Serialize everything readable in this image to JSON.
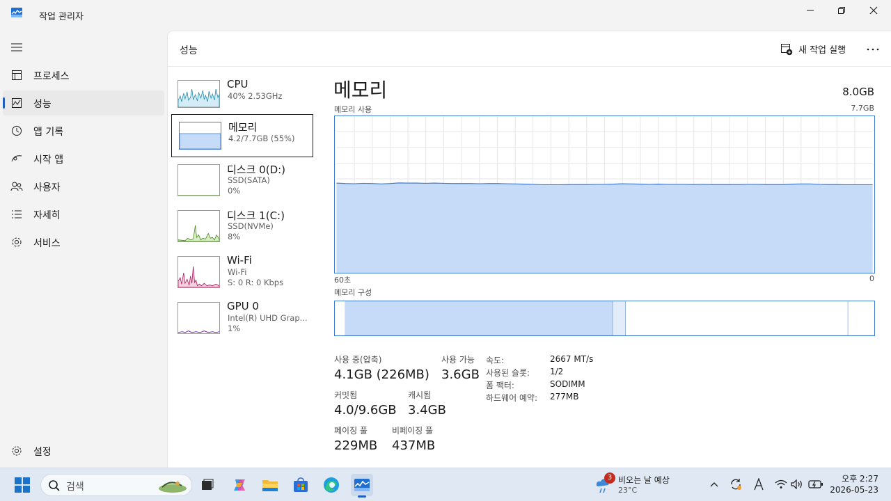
{
  "window": {
    "title": "작업 관리자"
  },
  "sidebar": {
    "items": [
      {
        "label": "프로세스",
        "icon": "processes-icon"
      },
      {
        "label": "성능",
        "icon": "performance-icon"
      },
      {
        "label": "앱 기록",
        "icon": "app-history-icon"
      },
      {
        "label": "시작 앱",
        "icon": "startup-apps-icon"
      },
      {
        "label": "사용자",
        "icon": "users-icon"
      },
      {
        "label": "자세히",
        "icon": "details-icon"
      },
      {
        "label": "서비스",
        "icon": "services-icon"
      }
    ],
    "settings_label": "설정"
  },
  "header": {
    "title": "성능",
    "run_task_label": "새 작업 실행"
  },
  "devices": [
    {
      "name": "CPU",
      "sub1": "40% 2.53GHz",
      "sub2": "",
      "color": "#1a8aaa"
    },
    {
      "name": "메모리",
      "sub1": "4.2/7.7GB (55%)",
      "sub2": "",
      "color": "#3f7ad1"
    },
    {
      "name": "디스크 0(D:)",
      "sub1": "SSD(SATA)",
      "sub2": "0%",
      "color": "#4c8a1f"
    },
    {
      "name": "디스크 1(C:)",
      "sub1": "SSD(NVMe)",
      "sub2": "8%",
      "color": "#4c8a1f"
    },
    {
      "name": "Wi-Fi",
      "sub1": "Wi-Fi",
      "sub2": "S: 0 R: 0 Kbps",
      "color": "#a8175a"
    },
    {
      "name": "GPU 0",
      "sub1": "Intel(R) UHD Grap...",
      "sub2": "1%",
      "color": "#7a1fa8"
    }
  ],
  "memory": {
    "title": "메모리",
    "total": "8.0GB",
    "usage_label": "메모리 사용",
    "usage_max": "7.7GB",
    "axis_left": "60초",
    "axis_right": "0",
    "composition_label": "메모리 구성",
    "stats": {
      "in_use_label": "사용 중(압축)",
      "in_use_value": "4.1GB (226MB)",
      "available_label": "사용 가능",
      "available_value": "3.6GB",
      "committed_label": "커밋됨",
      "committed_value": "4.0/9.6GB",
      "cached_label": "캐시됨",
      "cached_value": "3.4GB",
      "paged_label": "페이징 풀",
      "paged_value": "229MB",
      "nonpaged_label": "비페이징 풀",
      "nonpaged_value": "437MB"
    },
    "details": [
      {
        "key": "속도:",
        "value": "2667 MT/s"
      },
      {
        "key": "사용된 슬롯:",
        "value": "1/2"
      },
      {
        "key": "폼 팩터:",
        "value": "SODIMM"
      },
      {
        "key": "하드웨어 예약:",
        "value": "277MB"
      }
    ]
  },
  "chart_data": {
    "type": "area",
    "title": "메모리 사용",
    "xlabel": "",
    "ylabel": "",
    "x_range_label": [
      "60초",
      "0"
    ],
    "ylim": [
      0,
      7.7
    ],
    "grid": true,
    "values": [
      4.41,
      4.39,
      4.38,
      4.4,
      4.39,
      4.37,
      4.39,
      4.42,
      4.41,
      4.41,
      4.4,
      4.41,
      4.4,
      4.39,
      4.39,
      4.39,
      4.38,
      4.39,
      4.39,
      4.38,
      4.37,
      4.36,
      4.35,
      4.33,
      4.33,
      4.33,
      4.34,
      4.34,
      4.34,
      4.35,
      4.35,
      4.36,
      4.38,
      4.37,
      4.36,
      4.35,
      4.36,
      4.35,
      4.35,
      4.35,
      4.34,
      4.35,
      4.34,
      4.34,
      4.34,
      4.34,
      4.35,
      4.35,
      4.34,
      4.34,
      4.34,
      4.36,
      4.37,
      4.37,
      4.35,
      4.34,
      4.34,
      4.33,
      4.33,
      4.33,
      4.33
    ],
    "composition": {
      "in_use": 4.1,
      "modified": 0.2,
      "standby": 3.4,
      "free": 0.25
    }
  },
  "taskbar": {
    "search_placeholder": "검색",
    "weather_text": "비오는 날 예상",
    "weather_temp": "23°C",
    "weather_badge": "3",
    "time": "오후 2:27",
    "date": "2026-05-23"
  }
}
